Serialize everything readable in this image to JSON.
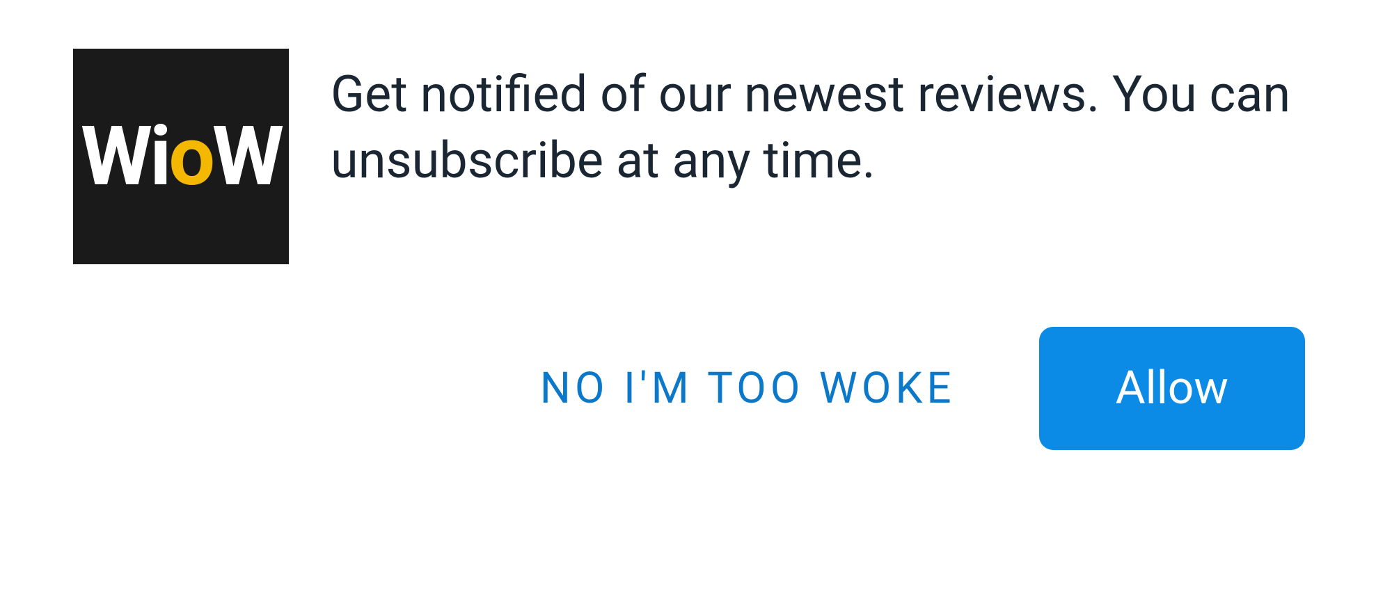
{
  "logo": {
    "part1": "W",
    "part2": "i",
    "part3": "o",
    "part4": "W"
  },
  "prompt": {
    "message": "Get notified of our newest reviews. You can unsubscribe at any time."
  },
  "buttons": {
    "deny_label": "NO I'M TOO WOKE",
    "allow_label": "Allow"
  },
  "colors": {
    "logo_bg": "#1a1a1a",
    "logo_accent": "#f5b800",
    "primary_button": "#0b8ae6",
    "link_text": "#0b78c9",
    "body_text": "#1a2733"
  }
}
